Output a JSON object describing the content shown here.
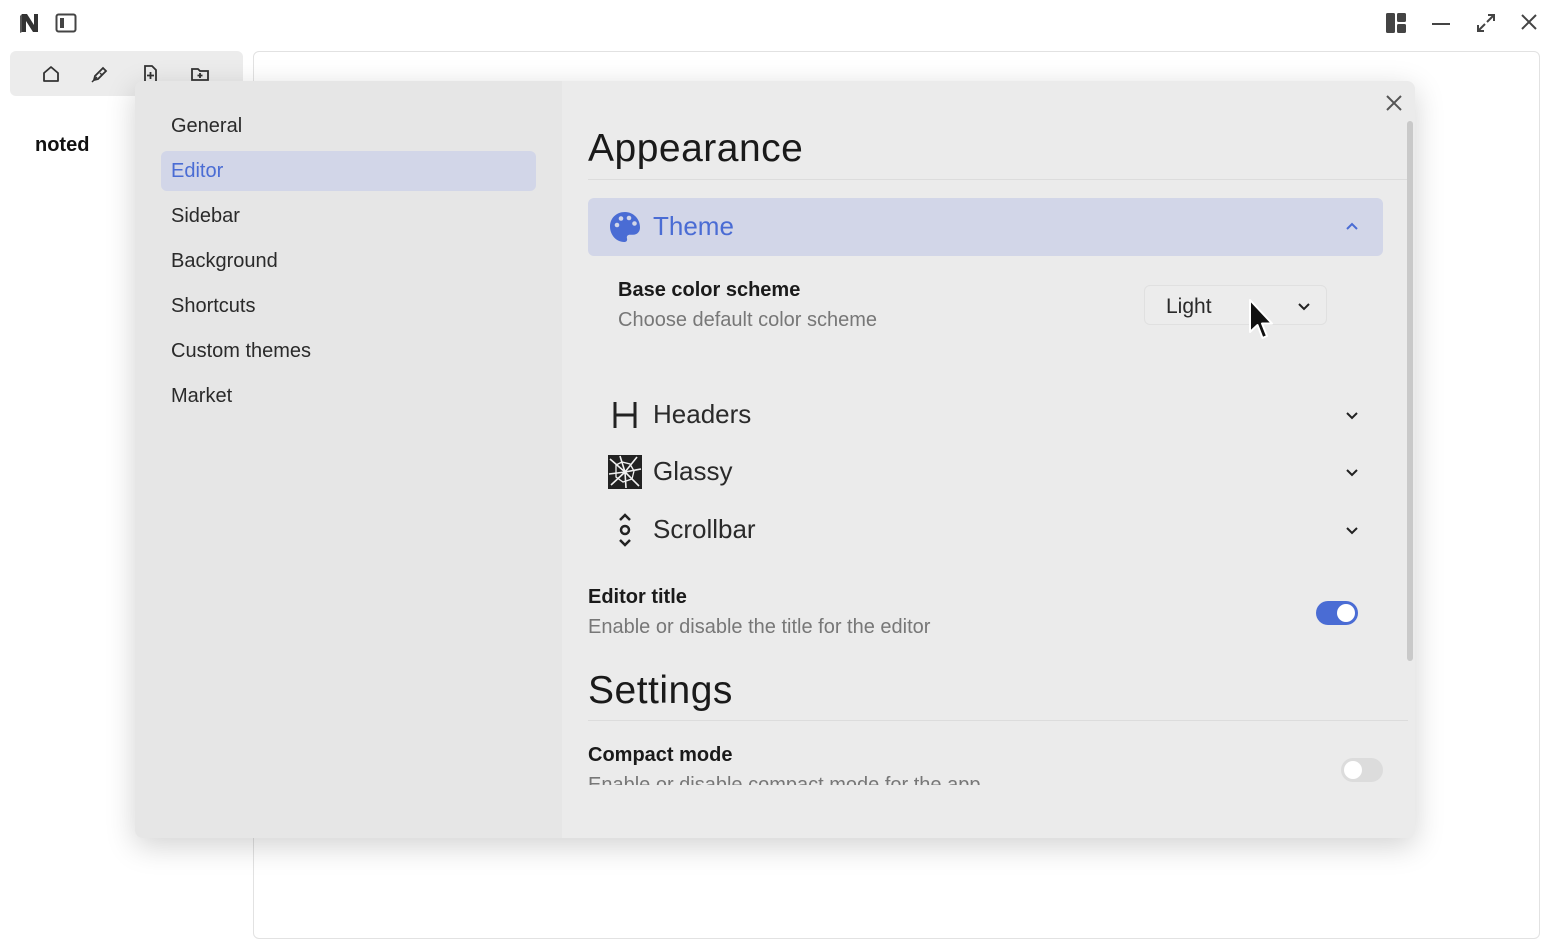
{
  "app": {
    "brand": "noted"
  },
  "topbar": {
    "logo_icon": "notion-n-icon",
    "sidebar_toggle_icon": "sidebar-toggle-icon",
    "layout_icon": "layout-icon",
    "minimize_icon": "minimize-icon",
    "maximize_icon": "maximize-icon",
    "close_icon": "close-icon"
  },
  "side_toolbar": {
    "items": [
      {
        "icon": "home-icon"
      },
      {
        "icon": "edit-icon"
      },
      {
        "icon": "new-file-icon"
      },
      {
        "icon": "new-folder-icon"
      }
    ]
  },
  "settings_nav": {
    "items": [
      {
        "label": "General"
      },
      {
        "label": "Editor",
        "active": true
      },
      {
        "label": "Sidebar"
      },
      {
        "label": "Background"
      },
      {
        "label": "Shortcuts"
      },
      {
        "label": "Custom themes"
      },
      {
        "label": "Market"
      }
    ]
  },
  "appearance": {
    "heading": "Appearance",
    "theme": {
      "label": "Theme",
      "icon": "palette-icon",
      "expanded": true,
      "base_color_scheme": {
        "title": "Base color scheme",
        "description": "Choose default color scheme",
        "value": "Light"
      }
    },
    "headers": {
      "label": "Headers",
      "icon": "heading-icon"
    },
    "glassy": {
      "label": "Glassy",
      "icon": "glass-icon"
    },
    "scrollbar": {
      "label": "Scrollbar",
      "icon": "scrollbar-icon"
    },
    "editor_title": {
      "title": "Editor title",
      "description": "Enable or disable the title for the editor",
      "enabled": true
    }
  },
  "settings_section": {
    "heading": "Settings",
    "compact_mode": {
      "title": "Compact mode",
      "description": "Enable or disable compact mode for the app",
      "enabled": false
    }
  },
  "colors": {
    "accent": "#4a6cd4",
    "active_bg": "#d2d6e8"
  }
}
